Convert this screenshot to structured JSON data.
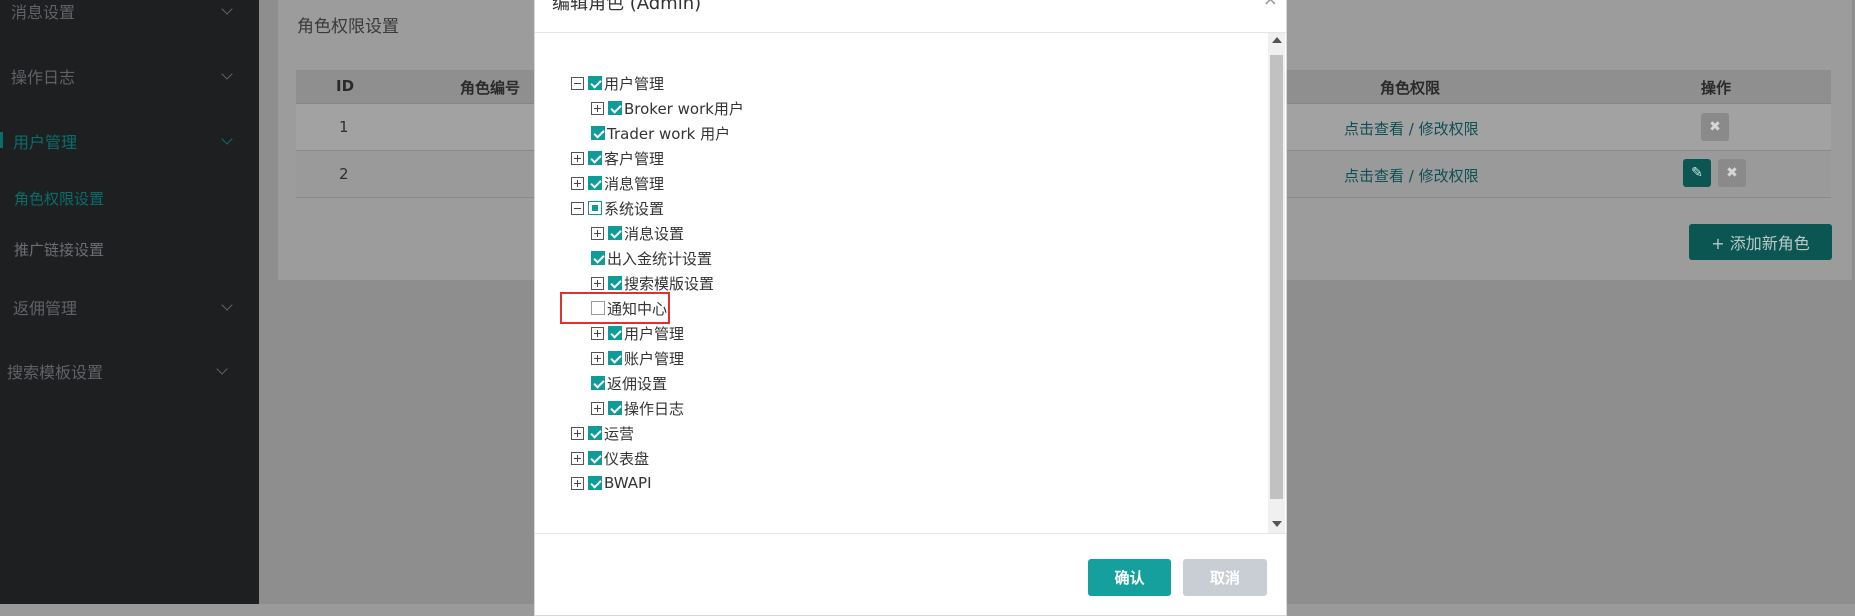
{
  "sidebar": {
    "items": [
      {
        "label": "消息设置"
      },
      {
        "label": "操作日志"
      },
      {
        "label": "用户管理"
      },
      {
        "label": "角色权限设置"
      },
      {
        "label": "推广链接设置"
      },
      {
        "label": "返佣管理"
      },
      {
        "label": "搜索模板设置"
      }
    ]
  },
  "page": {
    "title": "角色权限设置",
    "table": {
      "headers": [
        "ID",
        "角色编号",
        "角色权限",
        "操作"
      ],
      "rows": [
        {
          "id": "1",
          "permission_link": "点击查看 / 修改权限"
        },
        {
          "id": "2",
          "permission_link": "点击查看 / 修改权限"
        }
      ]
    },
    "add_button": "+ 添加新角色"
  },
  "modal": {
    "title": "编辑角色 (Admin)",
    "close": "×",
    "tree": [
      {
        "label": "用户管理"
      },
      {
        "label": "Broker work用户"
      },
      {
        "label": "Trader work 用户"
      },
      {
        "label": "客户管理"
      },
      {
        "label": "消息管理"
      },
      {
        "label": "系统设置"
      },
      {
        "label": "消息设置"
      },
      {
        "label": "出入金统计设置"
      },
      {
        "label": "搜索模版设置"
      },
      {
        "label": "通知中心"
      },
      {
        "label": "用户管理"
      },
      {
        "label": "账户管理"
      },
      {
        "label": "返佣设置"
      },
      {
        "label": "操作日志"
      },
      {
        "label": "运营"
      },
      {
        "label": "仪表盘"
      },
      {
        "label": "BWAPI"
      }
    ],
    "confirm": "确认",
    "cancel": "取消"
  },
  "colors": {
    "accent": "#16a09d",
    "highlight": "#e03030"
  }
}
